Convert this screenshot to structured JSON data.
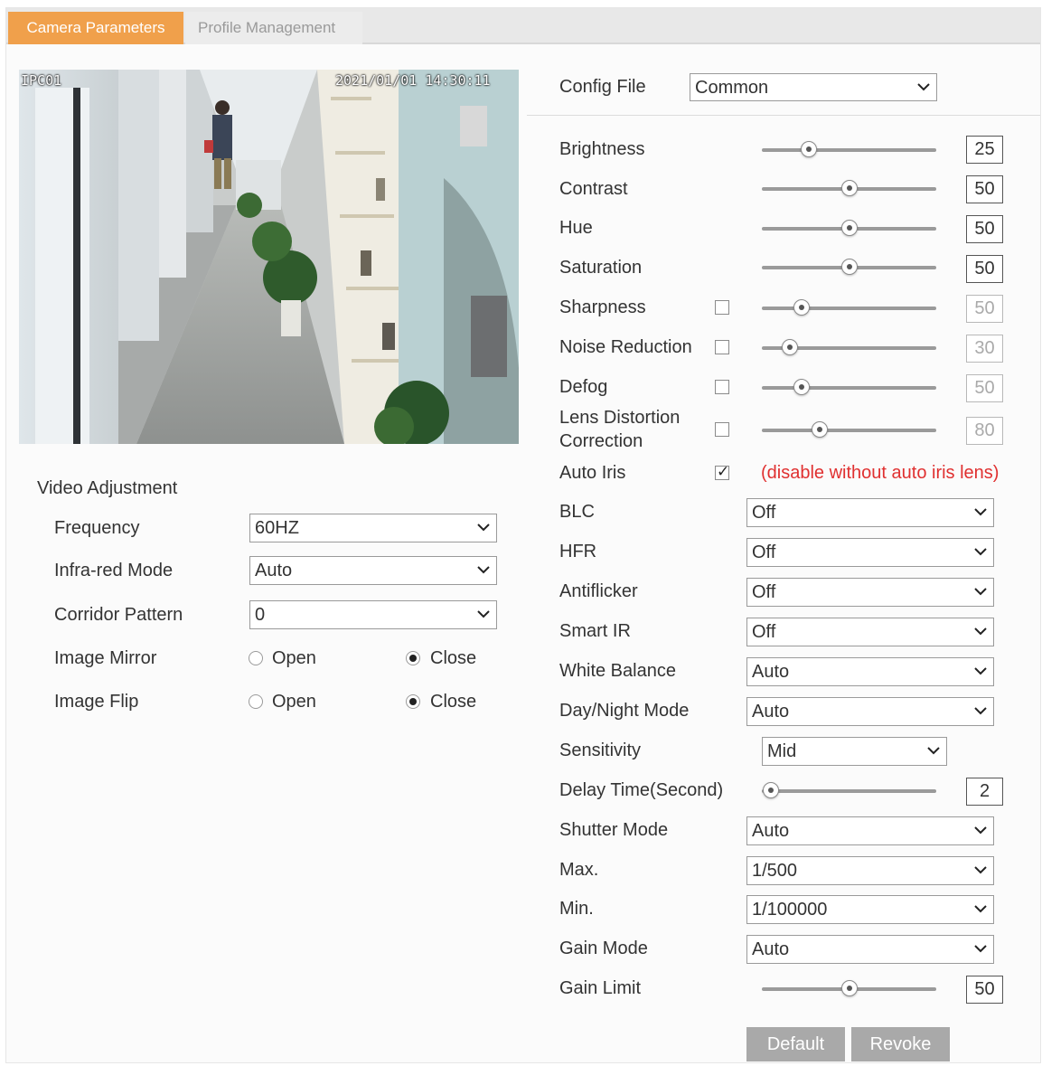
{
  "tabs": [
    {
      "label": "Camera Parameters",
      "active": true
    },
    {
      "label": "Profile Management",
      "active": false
    }
  ],
  "preview": {
    "channel": "IPC01",
    "timestamp": "2021/01/01 14:30:11"
  },
  "video_adjustment": {
    "title": "Video Adjustment",
    "frequency": {
      "label": "Frequency",
      "value": "60HZ"
    },
    "infrared_mode": {
      "label": "Infra-red Mode",
      "value": "Auto"
    },
    "corridor_pattern": {
      "label": "Corridor Pattern",
      "value": "0"
    },
    "image_mirror": {
      "label": "Image Mirror",
      "open_label": "Open",
      "close_label": "Close",
      "selected": "Close"
    },
    "image_flip": {
      "label": "Image Flip",
      "open_label": "Open",
      "close_label": "Close",
      "selected": "Close"
    }
  },
  "config_file": {
    "label": "Config File",
    "value": "Common"
  },
  "sliders": {
    "brightness": {
      "label": "Brightness",
      "value": "25",
      "level": 0.27,
      "has_checkbox": false,
      "enabled": true
    },
    "contrast": {
      "label": "Contrast",
      "value": "50",
      "level": 0.5,
      "has_checkbox": false,
      "enabled": true
    },
    "hue": {
      "label": "Hue",
      "value": "50",
      "level": 0.5,
      "has_checkbox": false,
      "enabled": true
    },
    "saturation": {
      "label": "Saturation",
      "value": "50",
      "level": 0.5,
      "has_checkbox": false,
      "enabled": true
    },
    "sharpness": {
      "label": "Sharpness",
      "value": "50",
      "level": 0.23,
      "has_checkbox": true,
      "checked": false,
      "enabled": false
    },
    "noise_reduction": {
      "label": "Noise Reduction",
      "value": "30",
      "level": 0.16,
      "has_checkbox": true,
      "checked": false,
      "enabled": false
    },
    "defog": {
      "label": "Defog",
      "value": "50",
      "level": 0.23,
      "has_checkbox": true,
      "checked": false,
      "enabled": false
    },
    "lens_distortion": {
      "label_line1": "Lens Distortion",
      "label_line2": "Correction",
      "value": "80",
      "level": 0.33,
      "has_checkbox": true,
      "checked": false,
      "enabled": false
    },
    "delay_time": {
      "label": "Delay Time(Second)",
      "value": "2",
      "level": 0.05,
      "has_checkbox": false,
      "enabled": true
    },
    "gain_limit": {
      "label": "Gain Limit",
      "value": "50",
      "level": 0.5,
      "has_checkbox": false,
      "enabled": true
    }
  },
  "auto_iris": {
    "label": "Auto Iris",
    "checked": true,
    "note": "(disable without auto iris lens)"
  },
  "dropdowns": {
    "blc": {
      "label": "BLC",
      "value": "Off"
    },
    "hfr": {
      "label": "HFR",
      "value": "Off"
    },
    "antiflicker": {
      "label": "Antiflicker",
      "value": "Off"
    },
    "smart_ir": {
      "label": "Smart IR",
      "value": "Off"
    },
    "white_balance": {
      "label": "White Balance",
      "value": "Auto"
    },
    "day_night_mode": {
      "label": "Day/Night Mode",
      "value": "Auto"
    },
    "sensitivity": {
      "label": "Sensitivity",
      "value": "Mid"
    },
    "shutter_mode": {
      "label": "Shutter Mode",
      "value": "Auto"
    },
    "max": {
      "label": "Max.",
      "value": "1/500"
    },
    "min": {
      "label": "Min.",
      "value": "1/100000"
    },
    "gain_mode": {
      "label": "Gain Mode",
      "value": "Auto"
    }
  },
  "buttons": {
    "default": "Default",
    "revoke": "Revoke"
  },
  "colors": {
    "accent_tab": "#f0a04b",
    "note_red": "#e03030",
    "button_gray": "#a9a9a9"
  }
}
